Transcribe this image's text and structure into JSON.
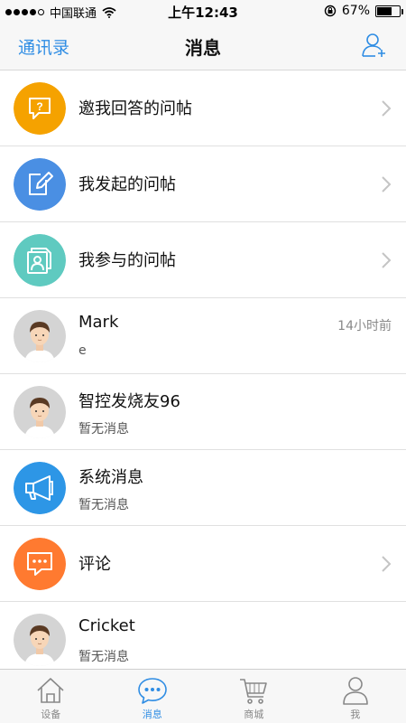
{
  "status_bar": {
    "carrier": "中国联通",
    "time": "上午12:43",
    "battery": "67%",
    "battery_level": 0.67
  },
  "nav": {
    "left_label": "通讯录",
    "title": "消息"
  },
  "rows": [
    {
      "title": "邀我回答的问帖",
      "icon": "question-bubble-icon",
      "color": "#f5a200"
    },
    {
      "title": "我发起的问帖",
      "icon": "edit-note-icon",
      "color": "#4a8fe3"
    },
    {
      "title": "我参与的问帖",
      "icon": "participant-doc-icon",
      "color": "#5fcac0"
    },
    {
      "title": "Mark",
      "subtitle": "e",
      "time": "14小时前",
      "icon": "avatar"
    },
    {
      "title": "智控发烧友96",
      "subtitle": "暂无消息",
      "icon": "avatar"
    },
    {
      "title": "系统消息",
      "subtitle": "暂无消息",
      "icon": "megaphone-icon",
      "color": "#2d96e6"
    },
    {
      "title": "评论",
      "icon": "comment-bubble-icon",
      "color": "#ff7a30"
    },
    {
      "title": "Cricket",
      "subtitle": "暂无消息",
      "icon": "avatar"
    }
  ],
  "tabs": [
    {
      "label": "设备",
      "icon": "home-icon"
    },
    {
      "label": "消息",
      "icon": "chat-bubble-icon",
      "active": true
    },
    {
      "label": "商城",
      "icon": "cart-icon"
    },
    {
      "label": "我",
      "icon": "person-icon"
    }
  ],
  "colors": {
    "accent": "#2f8de4"
  }
}
